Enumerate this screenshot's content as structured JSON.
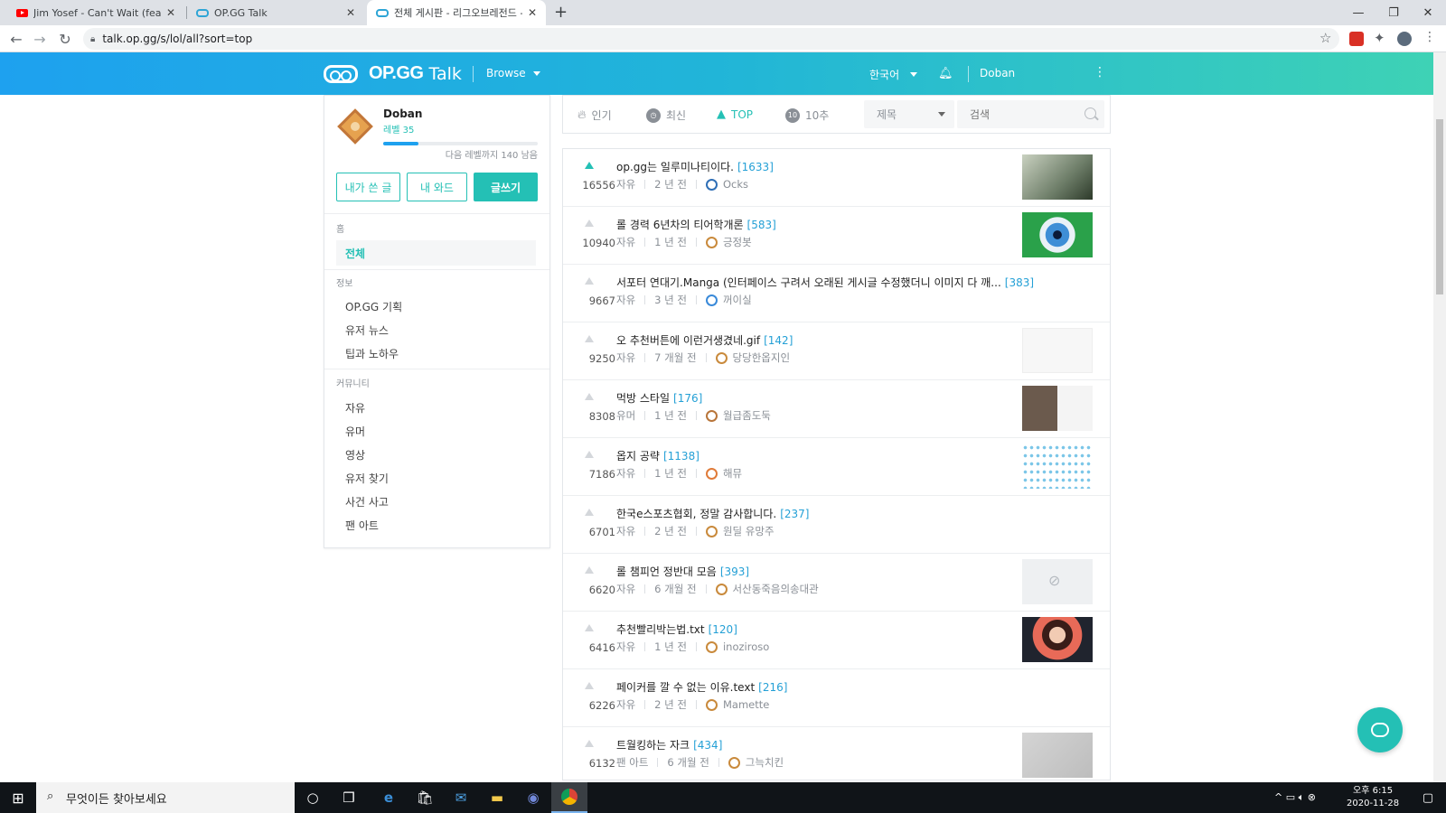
{
  "browser": {
    "tabs": [
      {
        "title": "Jim Yosef - Can't Wait (feat. An",
        "favicon": "youtube-icon"
      },
      {
        "title": "OP.GG Talk",
        "favicon": "opgg-icon"
      },
      {
        "title": "전체 게시판 - 리그오브레전드 -",
        "favicon": "opgg-icon",
        "active": true
      }
    ],
    "url": "talk.op.gg/s/lol/all?sort=top"
  },
  "header": {
    "logo": "OP.GG",
    "logo_suffix": "Talk",
    "browse": "Browse",
    "language": "한국어",
    "username": "Doban"
  },
  "profile": {
    "name": "Doban",
    "level": "레벨 35",
    "level_progress": 0.23,
    "next_level_text": "다음 레벨까지 140 남음",
    "buttons": {
      "my_posts": "내가 쓴 글",
      "my_wards": "내 와드",
      "write": "글쓰기"
    }
  },
  "sidebar": {
    "sections": [
      {
        "title": "홈",
        "items": [
          "전체"
        ]
      },
      {
        "title": "정보",
        "items": [
          "OP.GG 기획",
          "유저 뉴스",
          "팁과 노하우"
        ]
      },
      {
        "title": "커뮤니티",
        "items": [
          "자유",
          "유머",
          "영상",
          "유저 찾기",
          "사건 사고",
          "팬 아트"
        ]
      }
    ],
    "active_item": "전체"
  },
  "filters": {
    "tabs": [
      {
        "label": "인기",
        "icon": "flame-icon"
      },
      {
        "label": "최신",
        "icon": "clock-icon"
      },
      {
        "label": "TOP",
        "icon": "trophy-icon",
        "active": true
      },
      {
        "label": "10추",
        "icon": "ten-icon"
      }
    ],
    "select_value": "제목",
    "search_placeholder": "검색"
  },
  "posts": [
    {
      "votes": "16556",
      "title": "op.gg는 일루미나티이다.",
      "comments": "[1633]",
      "category": "자유",
      "time": "2 년 전",
      "author": "Ocks",
      "thumb": "illuminati-eye-image",
      "top": true
    },
    {
      "votes": "10940",
      "title": "롤 경력 6년차의 티어학개론",
      "comments": "[583]",
      "category": "자유",
      "time": "1 년 전",
      "author": "긍정봇",
      "thumb": "eye-closeup-image"
    },
    {
      "votes": "9667",
      "title": "서포터 연대기.Manga (인터페이스 구려서 오래된 게시글 수정했더니 이미지 다 깨...",
      "comments": "[383]",
      "category": "자유",
      "time": "3 년 전",
      "author": "꺼이실",
      "thumb": ""
    },
    {
      "votes": "9250",
      "title": "오 추천버튼에 이런거생겼네.gif",
      "comments": "[142]",
      "category": "자유",
      "time": "7 개월 전",
      "author": "당당한옵지인",
      "thumb": "vote-button-screenshot"
    },
    {
      "votes": "8308",
      "title": "먹방 스타일",
      "comments": "[176]",
      "category": "유머",
      "time": "1 년 전",
      "author": "월급좀도둑",
      "thumb": "mukbang-screenshot"
    },
    {
      "votes": "7186",
      "title": "옵지 공략",
      "comments": "[1138]",
      "category": "자유",
      "time": "1 년 전",
      "author": "해뮤",
      "thumb": "dots-grid-image"
    },
    {
      "votes": "6701",
      "title": "한국e스포츠협회, 정말 감사합니다.",
      "comments": "[237]",
      "category": "자유",
      "time": "2 년 전",
      "author": "원딜 유망주",
      "thumb": ""
    },
    {
      "votes": "6620",
      "title": "롤 챔피언 정반대 모음",
      "comments": "[393]",
      "category": "자유",
      "time": "6 개월 전",
      "author": "서산동죽음의송대관",
      "thumb": "hidden-image"
    },
    {
      "votes": "6416",
      "title": "추천빨리박는법.txt",
      "comments": "[120]",
      "category": "자유",
      "time": "1 년 전",
      "author": "inoziroso",
      "thumb": "girl-photo-image"
    },
    {
      "votes": "6226",
      "title": "페이커를 깔 수 없는 이유.text",
      "comments": "[216]",
      "category": "자유",
      "time": "2 년 전",
      "author": "Mamette",
      "thumb": ""
    },
    {
      "votes": "6132",
      "title": "트월킹하는 자크",
      "comments": "[434]",
      "category": "팬 아트",
      "time": "6 개월 전",
      "author": "그늑치킨",
      "thumb": "gray-image"
    }
  ],
  "taskbar": {
    "search_placeholder": "무엇이든 찾아보세요",
    "time": "오후 6:15",
    "date": "2020-11-28"
  },
  "colors": {
    "accent": "#24c0b5",
    "header_start": "#1ea1ef",
    "header_end": "#3ed2b5",
    "comment_count": "#24a0d6"
  }
}
